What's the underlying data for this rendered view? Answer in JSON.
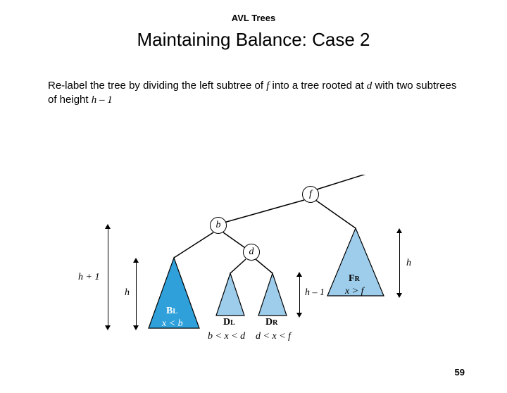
{
  "header": "AVL Trees",
  "title": "Maintaining Balance: Case 2",
  "body": {
    "pre": "Re-label the tree by dividing the left subtree of ",
    "f": "f",
    "mid": " into a tree rooted at ",
    "d": "d",
    "post1": " with two subtrees of height ",
    "hexpr": "h – 1"
  },
  "nodes": {
    "f": "f",
    "b": "b",
    "d": "d"
  },
  "subtrees": {
    "BL": "B",
    "BLsub": "L",
    "BLcond": "x < b",
    "DL": "D",
    "DLsub": "L",
    "DLcond": "b < x < d",
    "DR": "D",
    "DRsub": "R",
    "DRcond": "d < x < f",
    "FR": "F",
    "FRsub": "R",
    "FRcond": "x > f"
  },
  "heights": {
    "hplus1": "h + 1",
    "h_left": "h",
    "hminus1": "h – 1",
    "h_right": "h"
  },
  "pagenum": "59"
}
